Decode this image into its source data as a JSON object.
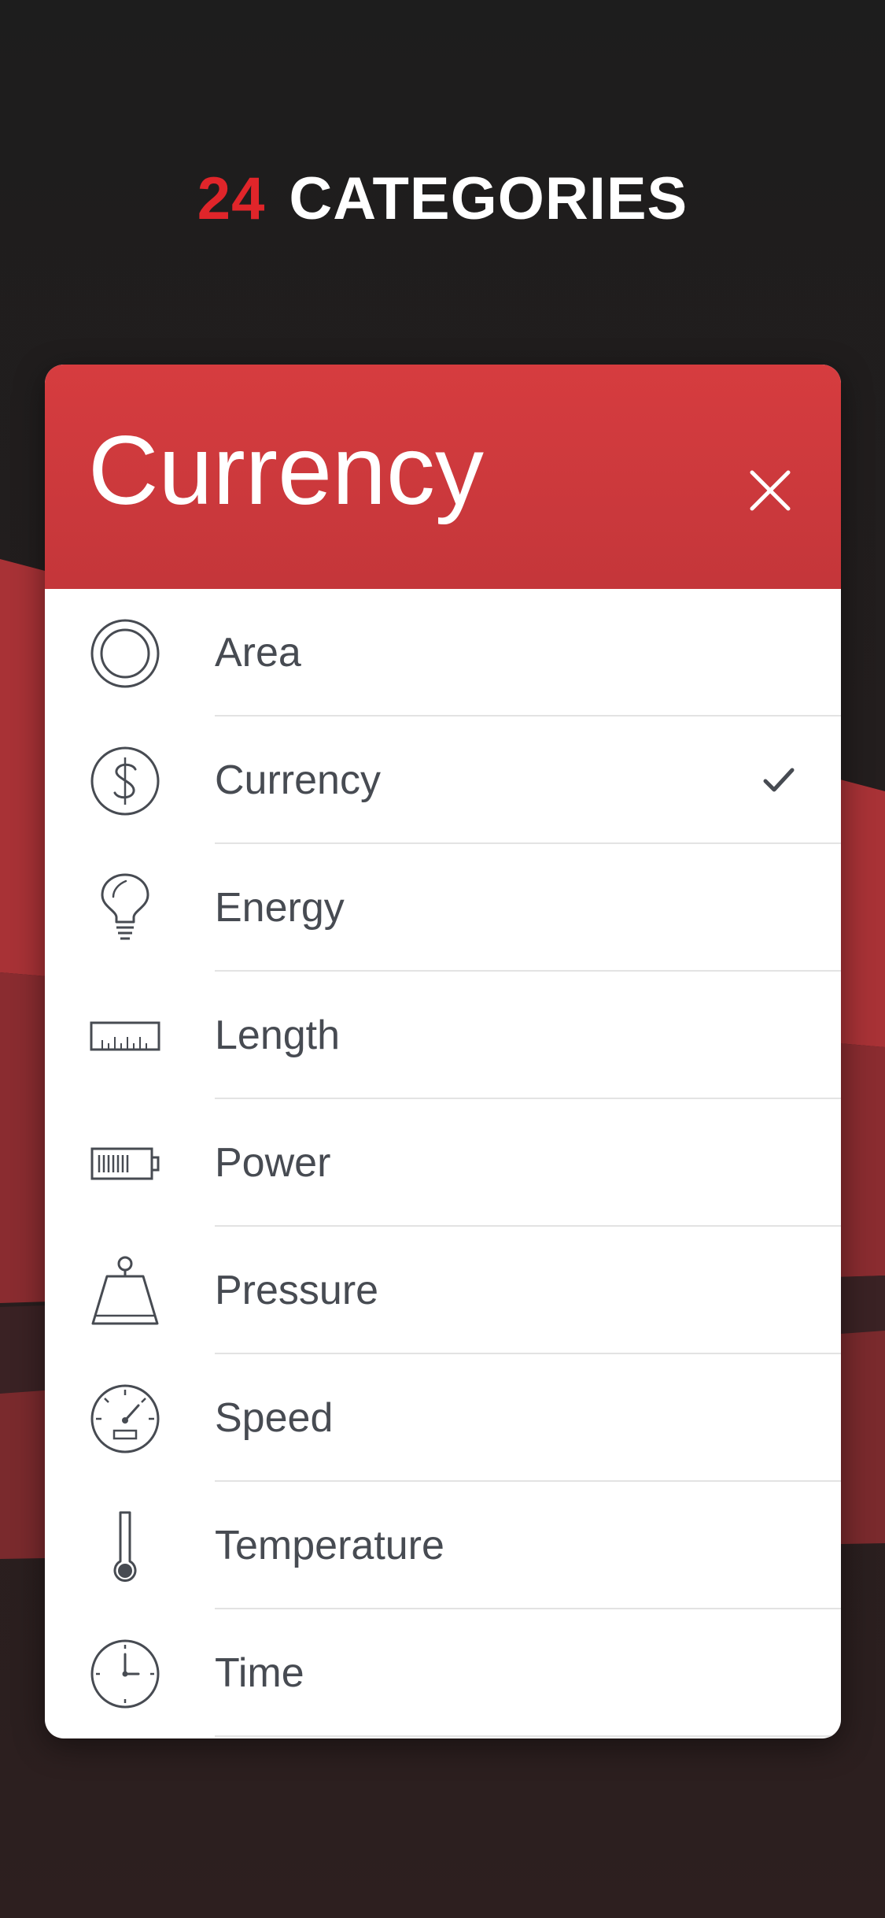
{
  "headline": {
    "count": "24",
    "text": "CATEGORIES"
  },
  "card": {
    "title": "Currency",
    "close_icon": "close-icon",
    "selected": "Currency",
    "items": [
      {
        "label": "Area",
        "icon": "area-icon"
      },
      {
        "label": "Currency",
        "icon": "currency-icon"
      },
      {
        "label": "Energy",
        "icon": "lightbulb-icon"
      },
      {
        "label": "Length",
        "icon": "ruler-icon"
      },
      {
        "label": "Power",
        "icon": "battery-icon"
      },
      {
        "label": "Pressure",
        "icon": "weight-icon"
      },
      {
        "label": "Speed",
        "icon": "speedometer-icon"
      },
      {
        "label": "Temperature",
        "icon": "thermometer-icon"
      },
      {
        "label": "Time",
        "icon": "clock-icon"
      }
    ]
  },
  "colors": {
    "accent": "#e0252a",
    "header": "#d03a3d",
    "background": "#1e1c1c",
    "text": "#474b52"
  }
}
